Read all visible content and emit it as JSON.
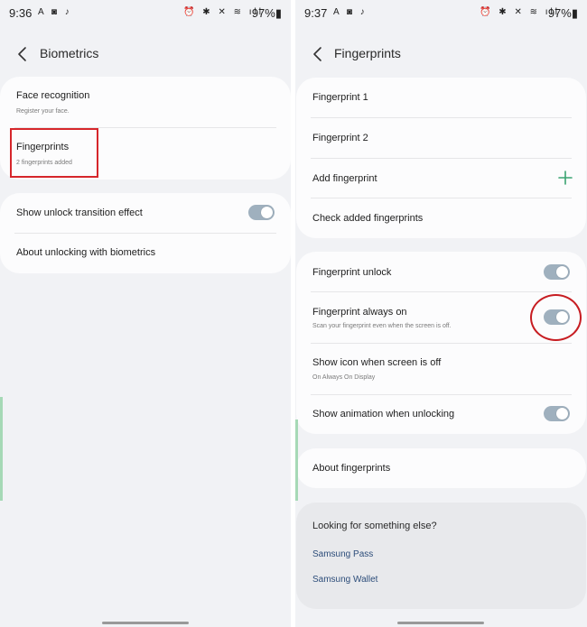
{
  "left_screen": {
    "status": {
      "time": "9:36",
      "left_icons": "A ◙ ♪",
      "right_icons": "⏰ ✱ ✕ ≋ ıll",
      "battery": "97%▮"
    },
    "title": "Biometrics",
    "card1": {
      "face_title": "Face recognition",
      "face_subtitle": "Register your face.",
      "fingerprints_title": "Fingerprints",
      "fingerprints_subtitle": "2 fingerprints added"
    },
    "card2": {
      "transition_label": "Show unlock transition effect",
      "transition_on": true,
      "about_label": "About unlocking with biometrics"
    }
  },
  "right_screen": {
    "status": {
      "time": "9:37",
      "left_icons": "A ◙ ♪",
      "right_icons": "⏰ ✱ ✕ ≋ ıll",
      "battery": "97%▮"
    },
    "title": "Fingerprints",
    "card1": {
      "fingerprint1": "Fingerprint 1",
      "fingerprint2": "Fingerprint 2",
      "add_label": "Add fingerprint",
      "check_label": "Check added fingerprints"
    },
    "card2": {
      "unlock_label": "Fingerprint unlock",
      "unlock_on": true,
      "always_on_label": "Fingerprint always on",
      "always_on_subtitle": "Scan your fingerprint even when the screen is off.",
      "always_on_on": true,
      "show_icon_label": "Show icon when screen is off",
      "show_icon_subtitle": "On Always On Display",
      "animation_label": "Show animation when unlocking",
      "animation_on": true
    },
    "card3": {
      "about_label": "About fingerprints"
    },
    "card4": {
      "title": "Looking for something else?",
      "link1": "Samsung Pass",
      "link2": "Samsung Wallet"
    }
  },
  "colors": {
    "background": "#f1f2f5",
    "card": "#fcfcfd",
    "toggle_on": "#9fb0be",
    "plus_icon": "#3aa371",
    "highlight_red": "#d6262b",
    "link": "#2d4d7a"
  }
}
